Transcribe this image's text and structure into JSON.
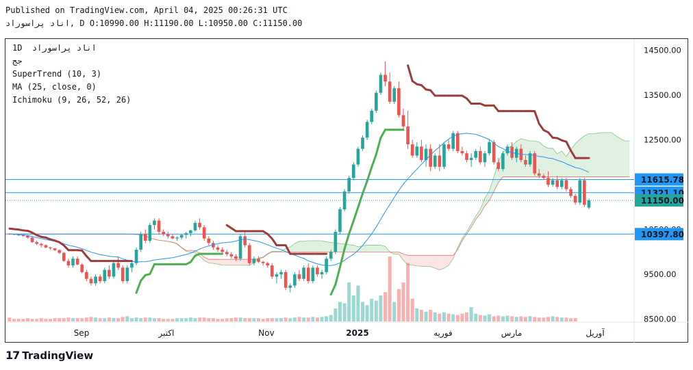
{
  "header": {
    "published": "Published on TradingView.com, April 04, 2025 00:26:31 UTC",
    "ohlc_line": "اناد پراسوراد, D O:10990.00 H:11190.00 L:10950.00 C:11150.00"
  },
  "legend": {
    "symbol": "1D  اناد پراسوراد",
    "exchange": "جج",
    "supertrend": "SuperTrend (10, 3)",
    "ma": "MA (25, close, 0)",
    "ichimoku": "Ichimoku (9, 26, 52, 26)"
  },
  "brand": {
    "logo_mark": "17",
    "name": "TradingView"
  },
  "colors": {
    "up": "#26a69a",
    "down": "#ef5350",
    "supertrend_up": "#4caf50",
    "supertrend_down": "#9c3c3c",
    "ma": "#2196f3",
    "cloud_bull": "#c8e6c9",
    "cloud_bear": "#ffcdd2",
    "hline": "#2196f3",
    "price_tag": "#2196f3",
    "last_tag": "#26a69a"
  },
  "chart_data": {
    "type": "candlestick",
    "y_axis": {
      "ticks": [
        "14500.00",
        "13500.00",
        "12500.00",
        "10500.00",
        "9500.00",
        "8500.00"
      ],
      "tick_values": [
        14500,
        13500,
        12500,
        10500,
        9500,
        8500
      ],
      "range": [
        8450,
        14750
      ]
    },
    "x_axis": {
      "labels": [
        "Sep",
        "اکتبر",
        "Nov",
        "2025",
        "فوریه",
        "مارس",
        "آوریل"
      ],
      "bold": [
        false,
        false,
        false,
        true,
        false,
        false,
        false
      ]
    },
    "price_tags": [
      {
        "value": 11615.78,
        "label": "11615.78",
        "kind": "hline"
      },
      {
        "value": 11321.1,
        "label": "11321.10",
        "kind": "hline"
      },
      {
        "value": 11150.0,
        "label": "11150.00",
        "kind": "last"
      },
      {
        "value": 10397.8,
        "label": "10397.80",
        "kind": "hline"
      }
    ],
    "candles": [
      [
        10410,
        10420,
        10380,
        10400
      ],
      [
        10400,
        10410,
        10370,
        10390
      ],
      [
        10390,
        10400,
        10360,
        10370
      ],
      [
        10370,
        10380,
        10340,
        10360
      ],
      [
        10360,
        10380,
        10300,
        10320
      ],
      [
        10320,
        10340,
        10200,
        10220
      ],
      [
        10220,
        10250,
        10150,
        10180
      ],
      [
        10180,
        10200,
        10100,
        10150
      ],
      [
        10150,
        10170,
        10080,
        10100
      ],
      [
        10100,
        10120,
        10050,
        10080
      ],
      [
        10080,
        10090,
        10020,
        10040
      ],
      [
        10040,
        10060,
        9950,
        9980
      ],
      [
        9980,
        10000,
        9780,
        9800
      ],
      [
        9800,
        9850,
        9650,
        9700
      ],
      [
        9700,
        9900,
        9650,
        9850
      ],
      [
        9850,
        9900,
        9700,
        9720
      ],
      [
        9720,
        9750,
        9520,
        9550
      ],
      [
        9550,
        9600,
        9350,
        9400
      ],
      [
        9400,
        9450,
        9250,
        9300
      ],
      [
        9300,
        9500,
        9250,
        9450
      ],
      [
        9450,
        9500,
        9300,
        9350
      ],
      [
        9350,
        9650,
        9300,
        9600
      ],
      [
        9600,
        9700,
        9400,
        9450
      ],
      [
        9450,
        9800,
        9400,
        9750
      ],
      [
        9750,
        9900,
        9600,
        9650
      ],
      [
        9650,
        9700,
        9300,
        9350
      ],
      [
        9350,
        9700,
        9300,
        9650
      ],
      [
        9650,
        9800,
        9550,
        9750
      ],
      [
        9750,
        10100,
        9700,
        10050
      ],
      [
        10050,
        10450,
        10000,
        10400
      ],
      [
        10400,
        10500,
        10200,
        10250
      ],
      [
        10250,
        10650,
        10200,
        10600
      ],
      [
        10600,
        10750,
        10500,
        10700
      ],
      [
        10700,
        10750,
        10400,
        10450
      ],
      [
        10450,
        10500,
        10350,
        10400
      ],
      [
        10400,
        10450,
        10300,
        10350
      ],
      [
        10350,
        10400,
        10280,
        10300
      ],
      [
        10300,
        10350,
        10250,
        10320
      ],
      [
        10320,
        10400,
        10280,
        10380
      ],
      [
        10380,
        10450,
        10300,
        10420
      ],
      [
        10420,
        10500,
        10350,
        10480
      ],
      [
        10480,
        10700,
        10450,
        10650
      ],
      [
        10650,
        10750,
        10500,
        10550
      ],
      [
        10550,
        10600,
        10250,
        10300
      ],
      [
        10300,
        10350,
        10150,
        10200
      ],
      [
        10200,
        10250,
        10050,
        10100
      ],
      [
        10100,
        10150,
        10000,
        10050
      ],
      [
        10050,
        10100,
        9950,
        10000
      ],
      [
        10000,
        10050,
        9900,
        9950
      ],
      [
        9950,
        10000,
        9850,
        9900
      ],
      [
        9900,
        9950,
        9800,
        9850
      ],
      [
        9850,
        10400,
        9800,
        10350
      ],
      [
        10350,
        10450,
        10100,
        10150
      ],
      [
        10150,
        10200,
        9700,
        9750
      ],
      [
        9750,
        9900,
        9700,
        9850
      ],
      [
        9850,
        9900,
        9750,
        9780
      ],
      [
        9780,
        9800,
        9700,
        9750
      ],
      [
        9750,
        9780,
        9650,
        9700
      ],
      [
        9700,
        9750,
        9400,
        9450
      ],
      [
        9450,
        9550,
        9300,
        9500
      ],
      [
        9500,
        9600,
        9400,
        9550
      ],
      [
        9550,
        9600,
        9150,
        9200
      ],
      [
        9200,
        9300,
        9100,
        9250
      ],
      [
        9250,
        9550,
        9200,
        9500
      ],
      [
        9500,
        9600,
        9350,
        9400
      ],
      [
        9400,
        9700,
        9350,
        9650
      ],
      [
        9650,
        9750,
        9300,
        9350
      ],
      [
        9350,
        9700,
        9300,
        9650
      ],
      [
        9650,
        9700,
        9450,
        9500
      ],
      [
        9500,
        9600,
        9400,
        9550
      ],
      [
        9550,
        9900,
        9500,
        9850
      ],
      [
        9850,
        10050,
        9800,
        10000
      ],
      [
        10000,
        10500,
        9950,
        10450
      ],
      [
        10450,
        11000,
        10400,
        10950
      ],
      [
        10950,
        11400,
        10900,
        11350
      ],
      [
        11350,
        11700,
        11300,
        11650
      ],
      [
        11650,
        12000,
        11600,
        11950
      ],
      [
        11950,
        12350,
        11900,
        12300
      ],
      [
        12300,
        12600,
        12250,
        12550
      ],
      [
        12550,
        12950,
        12500,
        12900
      ],
      [
        12900,
        13200,
        12850,
        13150
      ],
      [
        13150,
        13600,
        13100,
        13550
      ],
      [
        13550,
        14000,
        13500,
        13950
      ],
      [
        13950,
        14250,
        13700,
        13800
      ],
      [
        13800,
        14000,
        13300,
        13350
      ],
      [
        13350,
        13700,
        13300,
        13650
      ],
      [
        13650,
        13800,
        13000,
        13050
      ],
      [
        13050,
        13200,
        12700,
        12800
      ],
      [
        12800,
        13150,
        12300,
        12400
      ],
      [
        12400,
        12500,
        12100,
        12150
      ],
      [
        12150,
        12450,
        12100,
        12350
      ],
      [
        12350,
        12500,
        12000,
        12050
      ],
      [
        12050,
        12400,
        11900,
        12300
      ],
      [
        12300,
        12400,
        11800,
        11900
      ],
      [
        11900,
        12200,
        11850,
        12150
      ],
      [
        12150,
        12400,
        11800,
        11900
      ],
      [
        11900,
        12450,
        11850,
        12400
      ],
      [
        12400,
        12500,
        12250,
        12300
      ],
      [
        12300,
        12700,
        12250,
        12650
      ],
      [
        12650,
        12700,
        12200,
        12250
      ],
      [
        12250,
        12350,
        12150,
        12200
      ],
      [
        12200,
        12250,
        12000,
        12050
      ],
      [
        12050,
        12200,
        11900,
        12100
      ],
      [
        12100,
        12300,
        12050,
        12250
      ],
      [
        12250,
        12350,
        11950,
        12000
      ],
      [
        12000,
        12250,
        11900,
        12200
      ],
      [
        12200,
        12500,
        12150,
        12450
      ],
      [
        12450,
        12500,
        11950,
        12000
      ],
      [
        12000,
        12100,
        11800,
        11850
      ],
      [
        11850,
        12250,
        11800,
        12200
      ],
      [
        12200,
        12400,
        12150,
        12350
      ],
      [
        12350,
        12450,
        12050,
        12100
      ],
      [
        12100,
        12350,
        12000,
        12300
      ],
      [
        12300,
        12400,
        12000,
        12050
      ],
      [
        12050,
        12150,
        11900,
        11950
      ],
      [
        11950,
        12250,
        11900,
        12200
      ],
      [
        12200,
        12250,
        11700,
        11750
      ],
      [
        11750,
        11850,
        11650,
        11700
      ],
      [
        11700,
        11750,
        11600,
        11650
      ],
      [
        11650,
        11800,
        11450,
        11500
      ],
      [
        11500,
        11650,
        11450,
        11600
      ],
      [
        11600,
        11700,
        11400,
        11450
      ],
      [
        11450,
        11650,
        11400,
        11600
      ],
      [
        11600,
        11650,
        11350,
        11400
      ],
      [
        11400,
        11450,
        11200,
        11250
      ],
      [
        11250,
        11300,
        11050,
        11100
      ],
      [
        11100,
        11650,
        11050,
        11600
      ],
      [
        11600,
        11650,
        11000,
        11050
      ],
      [
        10990,
        11190,
        10950,
        11150
      ]
    ],
    "volume": [
      6,
      4,
      4,
      4,
      5,
      4,
      4,
      5,
      4,
      4,
      5,
      5,
      5,
      6,
      5,
      5,
      5,
      6,
      7,
      6,
      5,
      5,
      6,
      5,
      5,
      7,
      8,
      5,
      6,
      5,
      6,
      6,
      5,
      5,
      4,
      4,
      4,
      5,
      5,
      5,
      6,
      5,
      6,
      6,
      5,
      5,
      4,
      4,
      5,
      5,
      6,
      6,
      5,
      5,
      5,
      5,
      4,
      5,
      5,
      5,
      5,
      6,
      5,
      6,
      7,
      6,
      6,
      7,
      6,
      7,
      8,
      10,
      20,
      30,
      28,
      60,
      40,
      55,
      30,
      25,
      35,
      32,
      40,
      45,
      100,
      30,
      50,
      60,
      90,
      35,
      20,
      18,
      15,
      18,
      14,
      12,
      14,
      12,
      11,
      10,
      12,
      14,
      22,
      12,
      10,
      9,
      11,
      8,
      9,
      8,
      9,
      8,
      7,
      8,
      7,
      8,
      7,
      6,
      6,
      7,
      8,
      7,
      6,
      6,
      5,
      5
    ]
  }
}
